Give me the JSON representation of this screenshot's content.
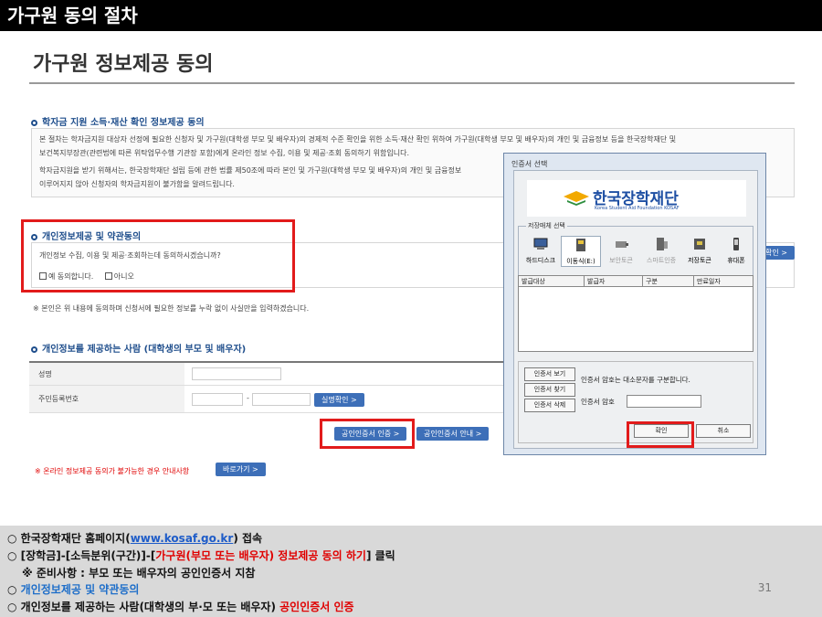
{
  "slide": {
    "title": "가구원 동의 절차",
    "page_number": "31"
  },
  "page": {
    "title": "가구원 정보제공 동의"
  },
  "section1": {
    "heading": "학자금 지원 소득·재산 확인 정보제공 동의",
    "para1_line1": "본 절차는 학자금지원 대상자 선정에 필요한 신청자 및 가구원(대학생 부모 및 배우자)의 경제적 수준 확인을 위한 소득·재산 확인 위하여 가구원(대학생 부모 및 배우자)의 개인 및 금융정보 등을 한국장학재단 및",
    "para1_line2": "보건복지부장관(관련법에 따른 위탁업무수행 기관장 포함)에게 온라인 정보 수집, 이용 및 제공·조회 동의하기 위함입니다.",
    "para2_line1": "학자금지원을 받기 위해서는, 한국장학재단 설립 등에 관한 법률 제50조에 따라 본인 및 가구원(대학생 부모 및 배우자)의 개인 및 금융정보",
    "para2_line2": "이루어지지 않아 신청자의 학자금지원이 불가함을 알려드립니다."
  },
  "section2": {
    "heading": "개인정보제공 및 약관동의",
    "question": "개인정보 수집, 이용 및 제공·조회하는데 동의하시겠습니까?",
    "option_yes": "예 동의합니다.",
    "option_no": "아니오",
    "note": "※ 본인은 위 내용에 동의하며 신청서에 필요한 정보를 누락 없이 사실만을 입력하겠습니다.",
    "confirm_button": "확인 >"
  },
  "section3": {
    "heading": "개인정보를 제공하는 사람 (대학생의 부모 및 배우자)",
    "name_label": "성명",
    "rrn_label": "주민등록번호",
    "rrn_separator": "-",
    "verify_button": "실명확인 >",
    "cert_auth_button": "공인인증서 인증 >",
    "cert_guide_button": "공인인증서 안내 >",
    "notice": "※ 온라인 정보제공 동의가 불가능한 경우 안내사항",
    "shortcut_button": "바로가기 >"
  },
  "dialog": {
    "title": "인증서 선택",
    "logo_text": "한국장학재단",
    "logo_sub": "Korea Student Aid Foundation KOSAF",
    "media_group_label": "저장매체 선택",
    "media": [
      {
        "label": "하드디스크",
        "icon": "hard-disk-icon"
      },
      {
        "label": "이동식(E:)",
        "icon": "removable-disk-icon"
      },
      {
        "label": "보안토큰",
        "icon": "security-token-icon"
      },
      {
        "label": "스마트인증",
        "icon": "smart-cert-icon"
      },
      {
        "label": "저장토큰",
        "icon": "storage-token-icon"
      },
      {
        "label": "휴대폰",
        "icon": "mobile-phone-icon"
      }
    ],
    "table_headers": [
      "발급대상",
      "발급자",
      "구분",
      "만료일자"
    ],
    "view_button": "인증서 보기",
    "find_button": "인증서 찾기",
    "delete_button": "인증서 삭제",
    "case_notice": "인증서 암호는 대소문자를 구분합니다.",
    "password_label": "인증서 암호",
    "ok_button": "확인",
    "cancel_button": "취소"
  },
  "instructions": {
    "line1_prefix": "○ 한국장학재단 홈페이지(",
    "line1_link": "www.kosaf.go.kr",
    "line1_suffix": ") 접속",
    "line2_prefix": "○ [장학금]-[소득분위(구간)]-[",
    "line2_red": "가구원(부모 또는 배우자) 정보제공 동의 하기",
    "line2_suffix": "] 클릭",
    "line3": "※ 준비사항 : 부모 또는 배우자의 공인인증서 지참",
    "line4_prefix": "○ ",
    "line4_blue": "개인정보제공 및 약관동의",
    "line5_prefix": "○ 개인정보를 제공하는 사람(대학생의 부·모 또는 배우자) ",
    "line5_red": "공인인증서 인증"
  },
  "colors": {
    "accent_blue": "#1f4e8c",
    "button_blue": "#3d6fb8",
    "highlight_red": "#e21b1b",
    "panel_gray": "#d9d9d9"
  }
}
